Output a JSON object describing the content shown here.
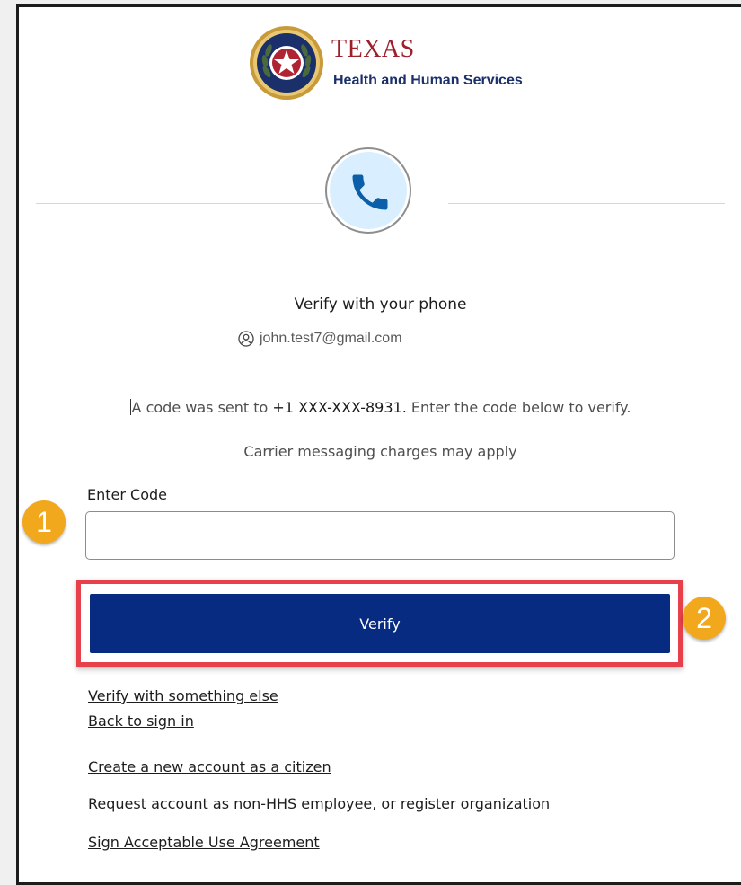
{
  "logo": {
    "title": "TEXAS",
    "subtitle": "Health and Human Services",
    "seal_icon": "texas-star-seal-icon"
  },
  "header": {
    "phone_icon": "phone-icon",
    "title": "Verify with your phone",
    "user_icon": "user-circle-icon",
    "user_email": "john.test7@gmail.com"
  },
  "message": {
    "prefix": "A code was sent to ",
    "phone": "+1 XXX-XXX-8931.",
    "suffix": "  Enter the code below to verify.",
    "carrier_note": "Carrier messaging charges may apply"
  },
  "form": {
    "code_label": "Enter Code",
    "code_value": "",
    "verify_label": "Verify"
  },
  "callouts": {
    "step_one": "1",
    "step_two": "2"
  },
  "links": {
    "verify_else": "Verify with something else",
    "back_sign_in": "Back to sign in",
    "create_account": "Create a new account as a citizen",
    "request_account": "Request account as non-HHS employee, or register organization",
    "sign_agreement": "Sign Acceptable Use Agreement"
  },
  "colors": {
    "brand_navy": "#062b80",
    "highlight_red": "#e8404a",
    "callout_orange": "#f2a81c",
    "texas_red": "#9c1f2b",
    "phone_blue": "#0b5ea8"
  }
}
